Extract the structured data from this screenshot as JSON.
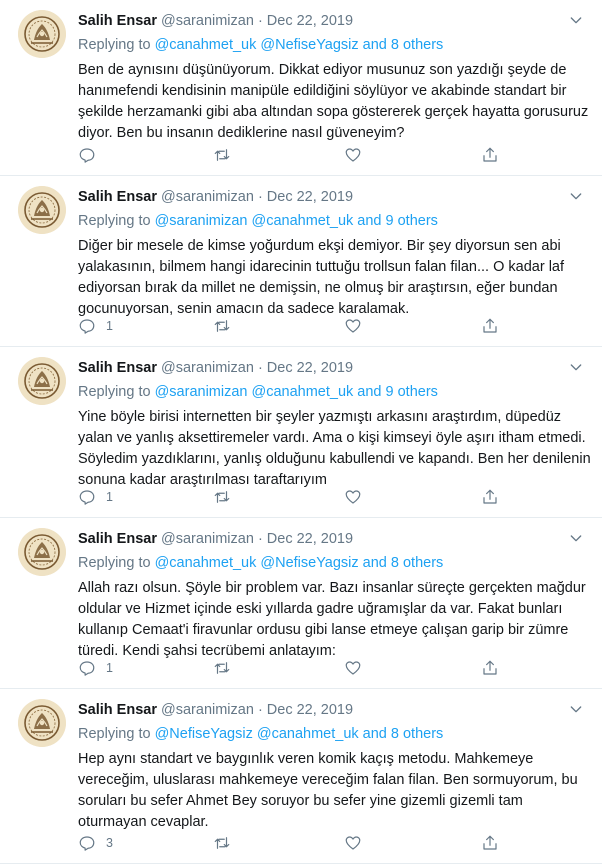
{
  "tweets": [
    {
      "name": "Salih Ensar",
      "handle": "@saranimizan",
      "date": "Dec 22, 2019",
      "replying_prefix": "Replying to ",
      "replying_to": "@canahmet_uk @NefiseYagsiz and 8 others",
      "text": "Ben de aynısını düşünüyorum. Dikkat ediyor musunuz son yazdığı şeyde de hanımefendi kendisinin manipüle edildiğini söylüyor ve akabinde standart bir şekilde herzamanki gibi aba altından sopa göstererek gerçek hayatta gorusuruz diyor. Ben bu insanın dediklerine nasıl güveneyim?",
      "reply_count": ""
    },
    {
      "name": "Salih Ensar",
      "handle": "@saranimizan",
      "date": "Dec 22, 2019",
      "replying_prefix": "Replying to ",
      "replying_to": "@saranimizan @canahmet_uk and 9 others",
      "text": "Diğer bir mesele de kimse yoğurdum ekşi demiyor. Bir şey diyorsun sen abi yalakasının, bilmem hangi idarecinin tuttuğu trollsun falan filan... O kadar laf ediyorsan bırak da millet ne demişsin, ne olmuş bir araştırsın, eğer bundan gocunuyorsan, senin amacın da sadece karalamak.",
      "reply_count": "1"
    },
    {
      "name": "Salih Ensar",
      "handle": "@saranimizan",
      "date": "Dec 22, 2019",
      "replying_prefix": "Replying to ",
      "replying_to": "@saranimizan @canahmet_uk and 9 others",
      "text": "Yine böyle birisi internetten bir şeyler yazmıştı arkasını araştırdım, düpedüz yalan ve yanlış aksettiremeler vardı. Ama o kişi kimseyi öyle aşırı itham etmedi. Söyledim yazdıklarını, yanlış olduğunu kabullendi ve kapandı. Ben her denilenin sonuna kadar araştırılması taraftarıyım",
      "reply_count": "1"
    },
    {
      "name": "Salih Ensar",
      "handle": "@saranimizan",
      "date": "Dec 22, 2019",
      "replying_prefix": "Replying to ",
      "replying_to": "@canahmet_uk @NefiseYagsiz and 8 others",
      "text": "Allah razı olsun. Şöyle bir problem var. Bazı insanlar süreçte gerçekten mağdur oldular ve Hizmet içinde eski yıllarda gadre uğramışlar da var. Fakat bunları kullanıp Cemaat'i firavunlar ordusu gibi lanse etmeye çalışan garip bir zümre türedi. Kendi şahsi tecrübemi anlatayım:",
      "reply_count": "1"
    },
    {
      "name": "Salih Ensar",
      "handle": "@saranimizan",
      "date": "Dec 22, 2019",
      "replying_prefix": "Replying to ",
      "replying_to": "@NefiseYagsiz @canahmet_uk and 8 others",
      "text": "Hep aynı standart ve baygınlık veren komik kaçış metodu. Mahkemeye vereceğim, uluslarası mahkemeye vereceğim falan filan. Ben sormuyorum, bu soruları bu sefer Ahmet Bey soruyor bu sefer yine gizemli gizemli tam oturmayan cevaplar.",
      "reply_count": "3"
    }
  ]
}
